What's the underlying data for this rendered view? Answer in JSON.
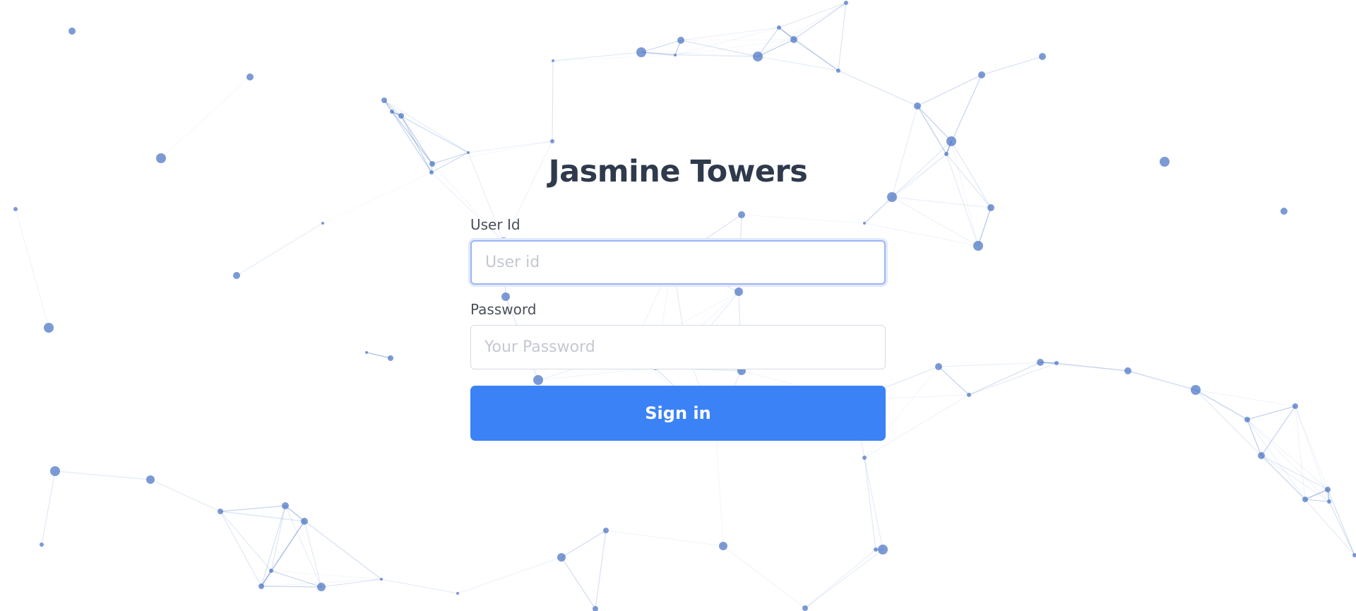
{
  "login": {
    "title": "Jasmine Towers",
    "user_id_label": "User Id",
    "user_id_placeholder": "User id",
    "password_label": "Password",
    "password_placeholder": "Your Password",
    "signin_label": "Sign in"
  },
  "background": {
    "accent_color": "#3b82f6",
    "node_color": "#4a73c4"
  }
}
